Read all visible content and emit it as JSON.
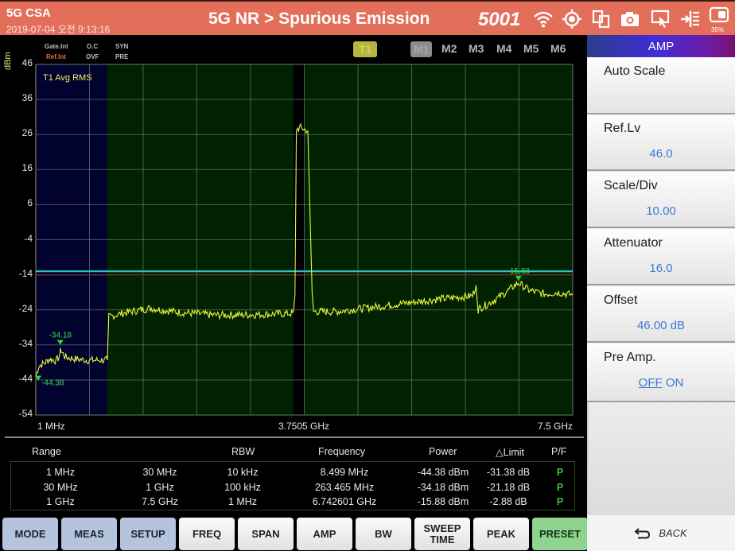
{
  "header": {
    "app_name": "5G CSA",
    "timestamp": "2019-07-04 오전 9:13:16",
    "title": "5G NR > Spurious Emission",
    "port": "5001",
    "battery_percent": "35%",
    "icons": [
      "wifi-icon",
      "gps-target-icon",
      "dual-window-icon",
      "camera-icon",
      "screen-touch-icon",
      "import-icon",
      "battery-icon"
    ]
  },
  "status": {
    "gate": "Gate.Int",
    "ref": "Ref.Int",
    "oc": "O.C",
    "ovf": "OVF",
    "syn": "SYN",
    "pre": "PRE"
  },
  "trace_tabs": [
    "T1"
  ],
  "marker_tabs": [
    "M1",
    "M2",
    "M3",
    "M4",
    "M5",
    "M6"
  ],
  "chart_data": {
    "type": "line",
    "title": "T1 Avg RMS",
    "ylabel": "dBm",
    "xlabel": "",
    "ylim": [
      -54,
      46
    ],
    "yticks": [
      46,
      36,
      26,
      16,
      6,
      -4,
      -14,
      -24,
      -34,
      -44,
      -54
    ],
    "x_tick_labels": [
      "1 MHz",
      "3.7505 GHz",
      "7.5 GHz"
    ],
    "xlim_ghz": [
      0.001,
      7.5
    ],
    "grid": true,
    "limit_line_dBm": -13,
    "limit_color": "#22c9c9",
    "trace_color": "#e8f53a",
    "series": [
      {
        "name": "T1 Avg RMS",
        "x_ghz": [
          0.001,
          0.01,
          0.03,
          0.1,
          0.2,
          0.26,
          0.2635,
          0.28,
          0.35,
          0.5,
          0.7,
          1.0,
          1.02,
          1.2,
          1.6,
          2.0,
          2.5,
          3.0,
          3.6,
          3.62,
          3.64,
          3.7,
          3.75,
          3.8,
          3.86,
          3.88,
          4.2,
          4.6,
          5.0,
          5.6,
          6.1,
          6.15,
          6.18,
          6.2,
          6.3,
          6.5,
          6.74,
          6.9,
          7.1,
          7.3,
          7.5
        ],
        "y_dBm": [
          -43,
          -40,
          -39,
          -38,
          -38.5,
          -37,
          -34.2,
          -36,
          -37.5,
          -38,
          -38.4,
          -38.3,
          -26,
          -25,
          -23.5,
          -24.7,
          -25.5,
          -25.4,
          -25,
          -20,
          27.5,
          28,
          27.5,
          27,
          -20,
          -24.5,
          -24.5,
          -23.5,
          -22.5,
          -21,
          -20,
          -17,
          -24,
          -23.5,
          -22.5,
          -20,
          -16.3,
          -18.5,
          -19.5,
          -19,
          -19.8
        ]
      }
    ],
    "markers": [
      {
        "label": "-44.38",
        "x_mhz": 8.499,
        "y_dBm": -44.38
      },
      {
        "label": "-34.18",
        "x_mhz": 263.465,
        "y_dBm": -34.18
      },
      {
        "label": "-15.88",
        "x_mhz": 6742.601,
        "y_dBm": -15.88
      }
    ],
    "regions": [
      {
        "name": "range-1",
        "start": "1 MHz",
        "end": "30 MHz",
        "color": "#00002b"
      },
      {
        "name": "range-2",
        "start": "30 MHz",
        "end": "1 GHz",
        "color": "#04043a"
      },
      {
        "name": "range-3",
        "start": "1 GHz",
        "end": "7.5 GHz",
        "color": "#002200"
      }
    ]
  },
  "table": {
    "headers": [
      "Range",
      "RBW",
      "Frequency",
      "Power",
      "△Limit",
      "P/F"
    ],
    "rows": [
      {
        "start": "1 MHz",
        "stop": "30 MHz",
        "rbw": "10 kHz",
        "frequency": "8.499 MHz",
        "power": "-44.38 dBm",
        "limit": "-31.38 dB",
        "pf": "P"
      },
      {
        "start": "30 MHz",
        "stop": "1 GHz",
        "rbw": "100 kHz",
        "frequency": "263.465 MHz",
        "power": "-34.18 dBm",
        "limit": "-21.18 dB",
        "pf": "P"
      },
      {
        "start": "1 GHz",
        "stop": "7.5 GHz",
        "rbw": "1 MHz",
        "frequency": "6.742601 GHz",
        "power": "-15.88 dBm",
        "limit": "-2.88 dB",
        "pf": "P"
      }
    ]
  },
  "bottom_buttons": [
    {
      "label": "MODE",
      "style": "blue"
    },
    {
      "label": "MEAS",
      "style": "blue"
    },
    {
      "label": "SETUP",
      "style": "blue"
    },
    {
      "label": "FREQ",
      "style": "white"
    },
    {
      "label": "SPAN",
      "style": "white"
    },
    {
      "label": "AMP",
      "style": "white"
    },
    {
      "label": "BW",
      "style": "white"
    },
    {
      "label": "SWEEP TIME",
      "style": "white"
    },
    {
      "label": "PEAK",
      "style": "white"
    },
    {
      "label": "PRESET",
      "style": "green"
    }
  ],
  "panel": {
    "title": "AMP",
    "items": [
      {
        "label": "Auto Scale",
        "value": ""
      },
      {
        "label": "Ref.Lv",
        "value": "46.0"
      },
      {
        "label": "Scale/Div",
        "value": "10.00"
      },
      {
        "label": "Attenuator",
        "value": "16.0"
      },
      {
        "label": "Offset",
        "value": "46.00 dB"
      },
      {
        "label": "Pre Amp.",
        "value_off": "OFF",
        "value_on": "ON",
        "selected": "OFF"
      }
    ],
    "back_label": "BACK"
  }
}
